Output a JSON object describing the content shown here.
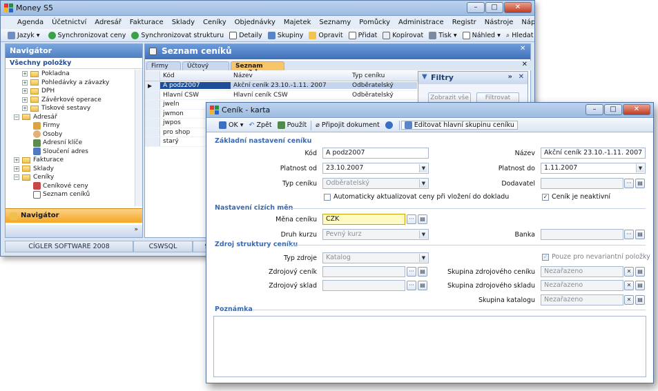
{
  "main": {
    "title": "Money S5",
    "menu": [
      "Agenda",
      "Účetnictví",
      "Adresář",
      "Fakturace",
      "Sklady",
      "Ceníky",
      "Objednávky",
      "Majetek",
      "Seznamy",
      "Pomůcky",
      "Administrace",
      "Registr",
      "Nástroje",
      "Nápověda"
    ],
    "toolbar": [
      "Jazyk",
      "Synchronizovat ceny",
      "Synchronizovat strukturu",
      "Detaily",
      "Skupiny",
      "Opravit",
      "Přidat",
      "Kopírovat",
      "Tisk",
      "Náhled",
      "Hledat"
    ],
    "navigator": {
      "title": "Navigátor",
      "subtitle": "Všechny položky",
      "items": [
        {
          "label": "Pokladna",
          "level": 2,
          "exp": "+"
        },
        {
          "label": "Pohledávky a závazky",
          "level": 2,
          "exp": "+"
        },
        {
          "label": "DPH",
          "level": 2,
          "exp": "+"
        },
        {
          "label": "Závěrkové operace",
          "level": 2,
          "exp": "+"
        },
        {
          "label": "Tiskové sestavy",
          "level": 2,
          "exp": "+"
        },
        {
          "label": "Adresář",
          "level": 1,
          "exp": "−"
        },
        {
          "label": "Firmy",
          "level": 3,
          "exp": ""
        },
        {
          "label": "Osoby",
          "level": 3,
          "exp": ""
        },
        {
          "label": "Adresní klíče",
          "level": 3,
          "exp": ""
        },
        {
          "label": "Sloučení adres",
          "level": 3,
          "exp": ""
        },
        {
          "label": "Fakturace",
          "level": 1,
          "exp": "+"
        },
        {
          "label": "Sklady",
          "level": 1,
          "exp": "+"
        },
        {
          "label": "Ceníky",
          "level": 1,
          "exp": "−"
        },
        {
          "label": "Ceníkové ceny",
          "level": 3,
          "exp": ""
        },
        {
          "label": "Seznam ceníků",
          "level": 3,
          "exp": ""
        }
      ],
      "button": "Navigátor"
    },
    "list": {
      "title": "Seznam ceníků",
      "tabs": [
        "Firmy",
        "Účtový rozvrh",
        "Seznam ceníků"
      ],
      "columns": [
        "Kód",
        "Název",
        "Typ ceníku"
      ],
      "rows": [
        {
          "kod": "A podz2007",
          "nazev": "Akční ceník 23.10.-1.11. 2007",
          "typ": "Odběratelský"
        },
        {
          "kod": "Hlavní CSW",
          "nazev": "Hlavní ceník CSW",
          "typ": "Odběratelský"
        },
        {
          "kod": "jweln",
          "nazev": "",
          "typ": ""
        },
        {
          "kod": "jwmon",
          "nazev": "",
          "typ": ""
        },
        {
          "kod": "jwpos",
          "nazev": "",
          "typ": ""
        },
        {
          "kod": "pro shop",
          "nazev": "",
          "typ": ""
        },
        {
          "kod": "starý",
          "nazev": "",
          "typ": ""
        }
      ]
    },
    "filters": {
      "title": "Filtry",
      "show_all": "Zobrazit vše",
      "filter": "Filtrovat"
    },
    "status": [
      "CÍGLER SOFTWARE 2008",
      "CSWSQL",
      "9.1"
    ]
  },
  "dialog": {
    "title": "Ceník - karta",
    "toolbar": [
      "OK",
      "Zpět",
      "Použít",
      "Připojit dokument",
      "Editovat hlavní skupinu ceníku"
    ],
    "sections": {
      "basic": "Základní nastavení ceníku",
      "currency": "Nastavení cizích měn",
      "source": "Zdroj struktury ceníku",
      "note": "Poznámka"
    },
    "fields": {
      "kod_label": "Kód",
      "kod": "A podz2007",
      "nazev_label": "Název",
      "nazev": "Akční ceník 23.10.-1.11. 2007",
      "platnost_od_label": "Platnost od",
      "platnost_od": "23.10.2007",
      "platnost_do_label": "Platnost do",
      "platnost_do": "1.11.2007",
      "typ_label": "Typ ceníku",
      "typ": "Odběratelský",
      "dodavatel_label": "Dodavatel",
      "dodavatel": "",
      "auto_label": "Automaticky aktualizovat ceny při vložení do dokladu",
      "neaktivni_label": "Ceník je neaktivní",
      "mena_label": "Měna ceníku",
      "mena": "CZK",
      "kurz_label": "Druh kurzu",
      "kurz": "Pevný kurz",
      "banka_label": "Banka",
      "banka": "",
      "zdroj_label": "Typ zdroje",
      "zdroj": "Katalog",
      "nevariant_label": "Pouze pro nevariantní položky",
      "zcenik_label": "Zdrojový ceník",
      "zcenik": "",
      "zsklad_label": "Zdrojový sklad",
      "zsklad": "",
      "sk_cenik_label": "Skupina zdrojového ceníku",
      "sk_cenik": "Nezařazeno",
      "sk_sklad_label": "Skupina zdrojového skladu",
      "sk_sklad": "Nezařazeno",
      "sk_kat_label": "Skupina katalogu",
      "sk_kat": "Nezařazeno"
    }
  }
}
